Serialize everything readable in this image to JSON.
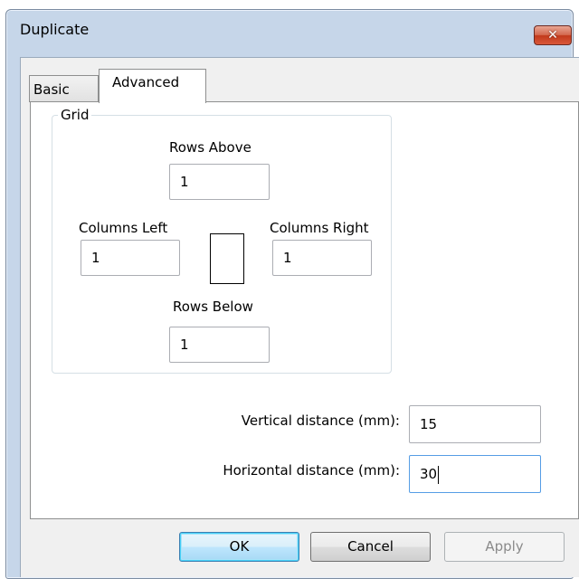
{
  "window": {
    "title": "Duplicate",
    "close_glyph": "✕"
  },
  "tabs": [
    {
      "label": "Basic",
      "selected": false
    },
    {
      "label": "Advanced",
      "selected": true
    }
  ],
  "grid": {
    "legend": "Grid",
    "rows_above": {
      "label": "Rows Above",
      "value": "1"
    },
    "columns_left": {
      "label": "Columns Left",
      "value": "1"
    },
    "columns_right": {
      "label": "Columns Right",
      "value": "1"
    },
    "rows_below": {
      "label": "Rows Below",
      "value": "1"
    }
  },
  "distance": {
    "vertical": {
      "label": "Vertical distance (mm):",
      "value": "15"
    },
    "horizontal": {
      "label": "Horizontal distance (mm):",
      "value": "30"
    }
  },
  "buttons": {
    "ok": "OK",
    "cancel": "Cancel",
    "apply": "Apply"
  },
  "colors": {
    "frame": "#c6d6e9",
    "close_button": "#c23a1c",
    "focus_border": "#569de5",
    "default_button": "#3c7fb1"
  }
}
